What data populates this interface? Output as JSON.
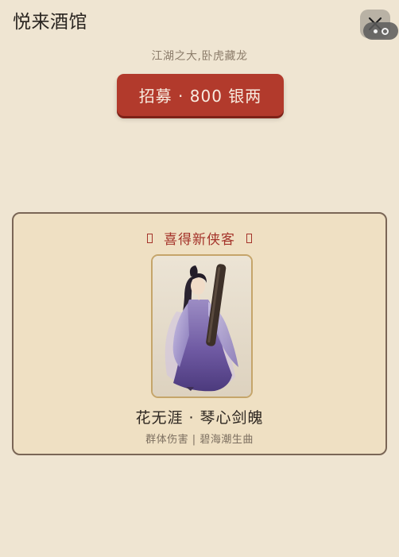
{
  "header": {
    "title": "悦来酒馆",
    "close_icon": "close-icon",
    "more_icon": "more-options-icon"
  },
  "tavern": {
    "subtitle": "江湖之大,卧虎藏龙",
    "recruit_label": "招募 · 800 银两"
  },
  "result": {
    "header_text": "喜得新侠客",
    "header_icon_left": "unrendered-glyph-icon",
    "header_icon_right": "unrendered-glyph-icon",
    "hero_name": "花无涯 · 琴心剑魄",
    "hero_desc": "群体伤害 | 碧海潮生曲",
    "portrait": "hero-portrait-image"
  },
  "colors": {
    "background": "#efe5d2",
    "accent_red": "#b23a2c",
    "panel_bg": "#efe0c3",
    "panel_border": "#7a6656",
    "frame_gold": "#c5a56a"
  }
}
